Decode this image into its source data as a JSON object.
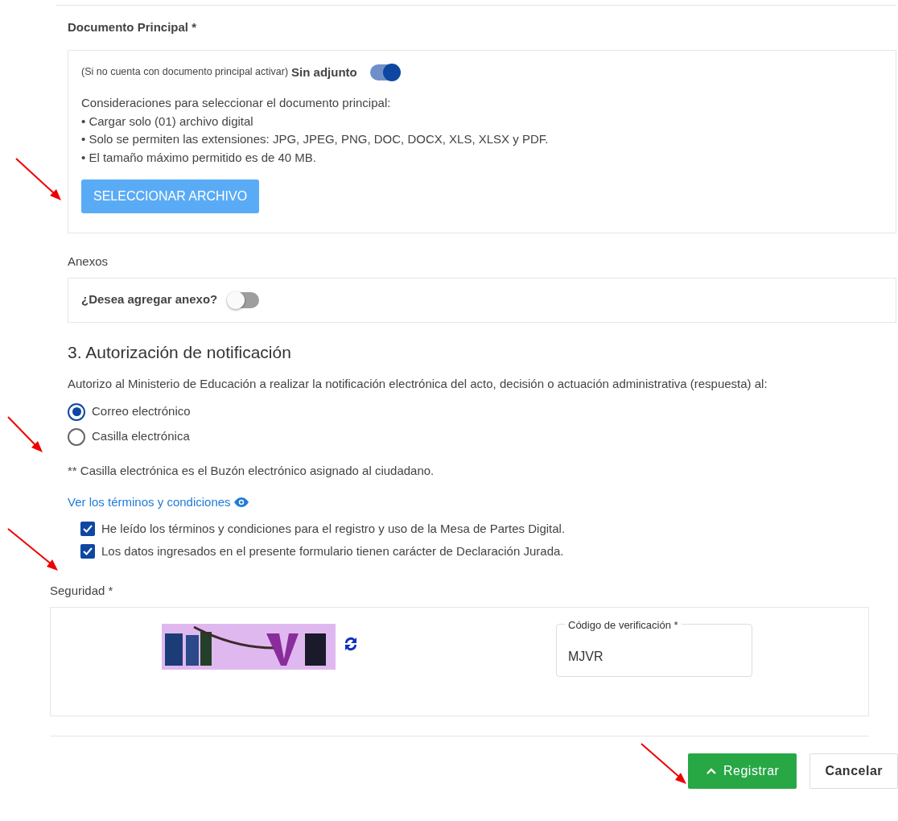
{
  "document": {
    "label": "Documento Principal *",
    "hint": "(Si no cuenta con documento principal activar)",
    "toggle_label": "Sin adjunto",
    "no_attachment": true,
    "considerations_title": "Consideraciones para seleccionar el documento principal:",
    "considerations": [
      "• Cargar solo (01) archivo digital",
      "• Solo se permiten las extensiones: JPG, JPEG, PNG, DOC, DOCX, XLS, XLSX y PDF.",
      "• El tamaño máximo permitido es de 40 MB."
    ],
    "select_button": "SELECCIONAR ARCHIVO"
  },
  "annexes": {
    "label": "Anexos",
    "question": "¿Desea agregar anexo?",
    "on": false
  },
  "notification": {
    "heading": "3. Autorización de notificación",
    "text": "Autorizo al Ministerio de Educación a realizar la notificación electrónica del acto, decisión o actuación administrativa (respuesta) al:",
    "options": [
      {
        "label": "Correo electrónico",
        "selected": true
      },
      {
        "label": "Casilla electrónica",
        "selected": false
      }
    ],
    "note": "** Casilla electrónica es el Buzón electrónico asignado al ciudadano.",
    "terms_link": "Ver los términos y condiciones",
    "agreements": [
      {
        "label": "He leído los términos y condiciones para el registro y uso de la Mesa de Partes Digital.",
        "checked": true
      },
      {
        "label": "Los datos ingresados en el presente formulario tienen carácter de Declaración Jurada.",
        "checked": true
      }
    ]
  },
  "security": {
    "label": "Seguridad *",
    "code_field": {
      "label": "Código de verificación *",
      "value": "MJVR"
    }
  },
  "actions": [
    {
      "label": "Registrar",
      "kind": "primary"
    },
    {
      "label": "Cancelar",
      "kind": "secondary"
    }
  ]
}
